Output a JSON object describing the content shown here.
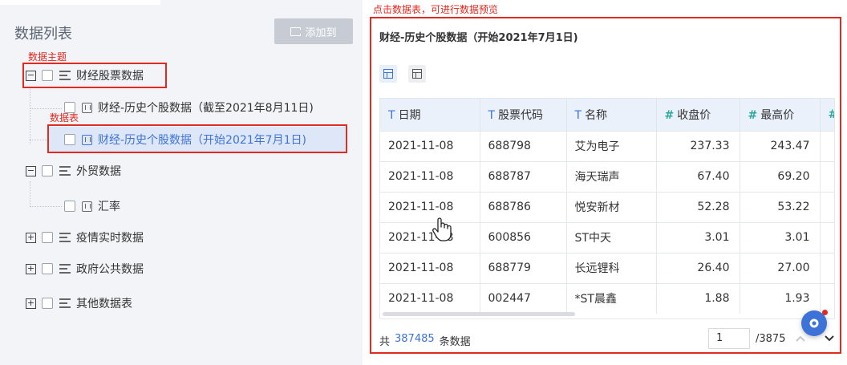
{
  "left_panel": {
    "title": "数据列表",
    "add_button_label": "添加到",
    "annotations": {
      "subject": "数据主题",
      "table": "数据表"
    },
    "tree": {
      "root_finance": {
        "toggle": "−",
        "label": "财经股票数据"
      },
      "finance_child_1": {
        "label": "财经-历史个股数据（截至2021年8月11日)"
      },
      "finance_child_2": {
        "label": "财经-历史个股数据（开始2021年7月1日)"
      },
      "root_trade": {
        "toggle": "−",
        "label": "外贸数据"
      },
      "trade_child_1": {
        "label": "汇率"
      },
      "root_covid": {
        "toggle": "+",
        "label": "疫情实时数据"
      },
      "root_gov": {
        "toggle": "+",
        "label": "政府公共数据"
      },
      "root_other": {
        "toggle": "+",
        "label": "其他数据表"
      }
    }
  },
  "right_panel": {
    "hint": "点击数据表，可进行数据预览",
    "title": "财经-历史个股数据（开始2021年7月1日)",
    "columns": [
      {
        "type_icon": "T",
        "label": "日期"
      },
      {
        "type_icon": "T",
        "label": "股票代码"
      },
      {
        "type_icon": "T",
        "label": "名称"
      },
      {
        "type_icon": "#",
        "label": "收盘价"
      },
      {
        "type_icon": "#",
        "label": "最高价"
      },
      {
        "type_icon": "#",
        "label": ""
      }
    ],
    "rows": [
      [
        "2021-11-08",
        "688798",
        "艾为电子",
        "237.33",
        "243.47"
      ],
      [
        "2021-11-08",
        "688787",
        "海天瑞声",
        "67.40",
        "69.20"
      ],
      [
        "2021-11-08",
        "688786",
        "悦安新材",
        "52.28",
        "53.22"
      ],
      [
        "2021-11-08",
        "600856",
        "ST中天",
        "3.01",
        "3.01"
      ],
      [
        "2021-11-08",
        "688779",
        "长远锂科",
        "26.40",
        "27.00"
      ],
      [
        "2021-11-08",
        "002447",
        "*ST晨鑫",
        "1.88",
        "1.93"
      ]
    ],
    "footer": {
      "prefix": "共",
      "count": "387485",
      "suffix": "条数据",
      "page": "1",
      "total_pages": "/3875"
    }
  },
  "colors": {
    "accent": "#3d72d9",
    "annotation_red": "#e02a22",
    "numeric_icon": "#2aa89a"
  }
}
